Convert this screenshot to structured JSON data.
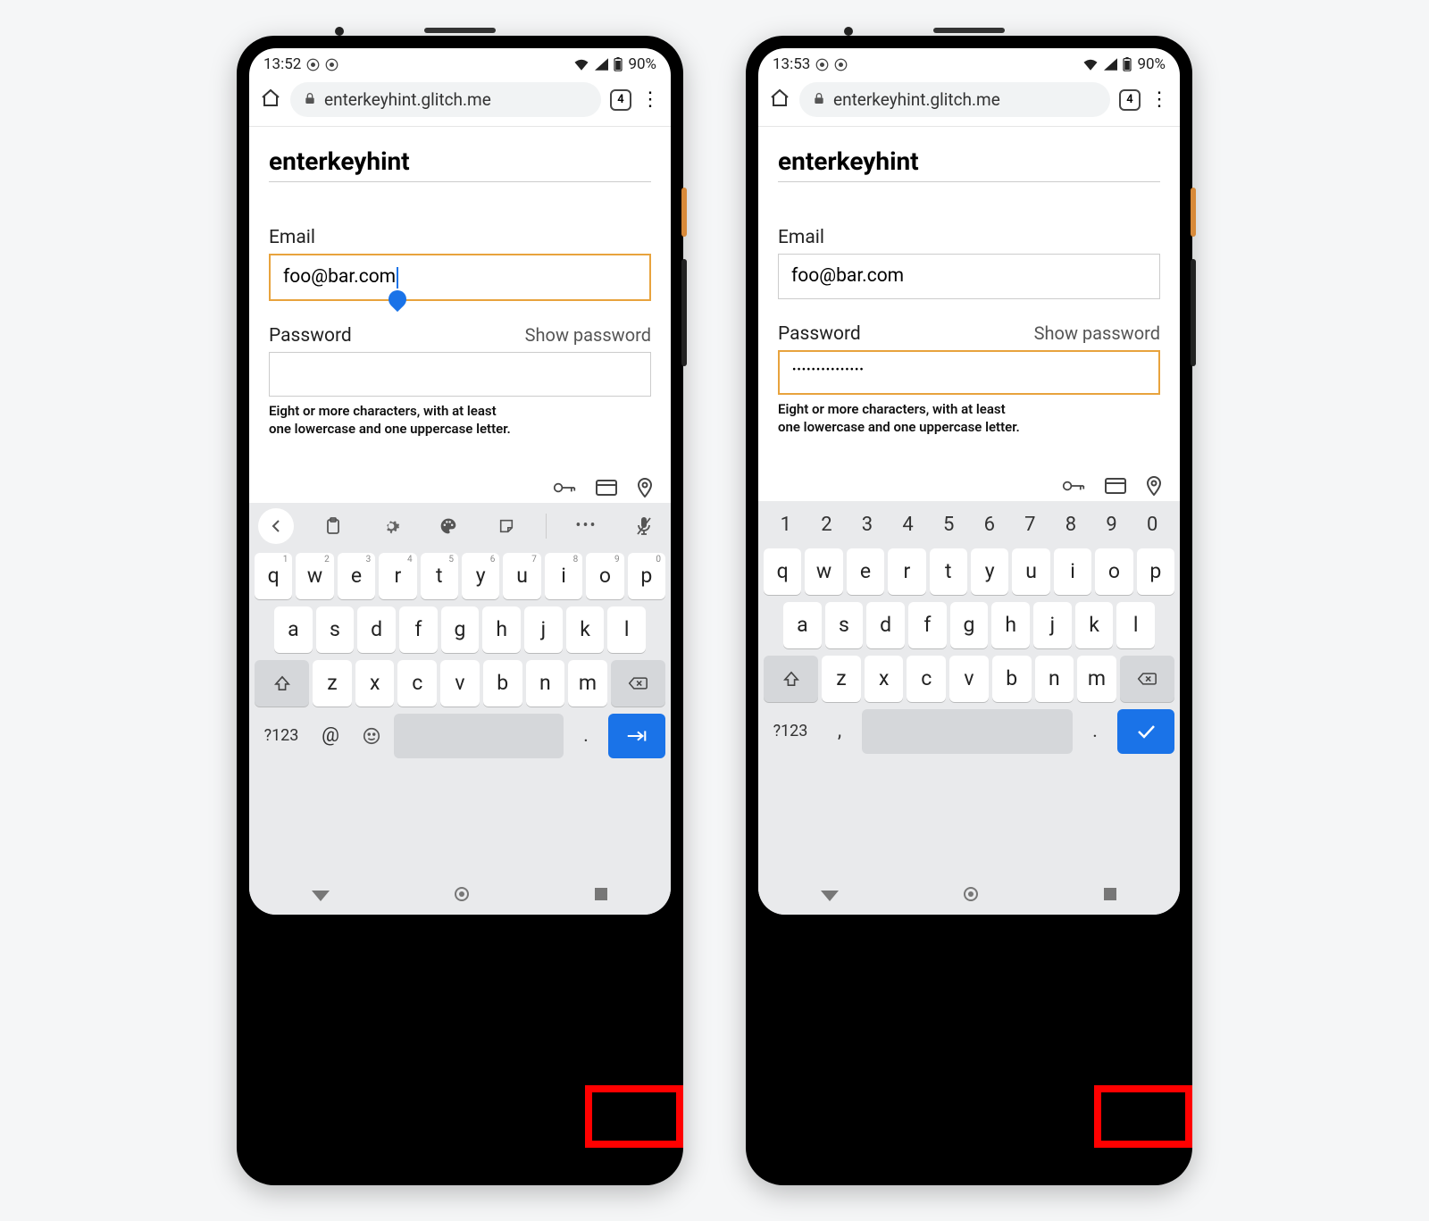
{
  "phones": [
    {
      "status": {
        "time": "13:52",
        "battery": "90%"
      },
      "url": "enterkeyhint.glitch.me",
      "tab_count": "4",
      "page": {
        "title": "enterkeyhint",
        "email_label": "Email",
        "email_value": "foo@bar.com",
        "email_focused": true,
        "password_label": "Password",
        "show_password": "Show password",
        "password_value": "",
        "password_focused": false,
        "hint_line1": "Eight or more characters, with at least",
        "hint_line2": "one lowercase and one uppercase letter."
      },
      "keyboard": {
        "has_toolbar": true,
        "has_number_row": false,
        "row1": [
          "q",
          "w",
          "e",
          "r",
          "t",
          "y",
          "u",
          "i",
          "o",
          "p"
        ],
        "row1_super": [
          "1",
          "2",
          "3",
          "4",
          "5",
          "6",
          "7",
          "8",
          "9",
          "0"
        ],
        "row2": [
          "a",
          "s",
          "d",
          "f",
          "g",
          "h",
          "j",
          "k",
          "l"
        ],
        "row3": [
          "z",
          "x",
          "c",
          "v",
          "b",
          "n",
          "m"
        ],
        "sym_label": "?123",
        "extra_key": "@",
        "period_key": ".",
        "enter_icon": "next"
      }
    },
    {
      "status": {
        "time": "13:53",
        "battery": "90%"
      },
      "url": "enterkeyhint.glitch.me",
      "tab_count": "4",
      "page": {
        "title": "enterkeyhint",
        "email_label": "Email",
        "email_value": "foo@bar.com",
        "email_focused": false,
        "password_label": "Password",
        "show_password": "Show password",
        "password_value": "•••••••••••••••",
        "password_focused": true,
        "hint_line1": "Eight or more characters, with at least",
        "hint_line2": "one lowercase and one uppercase letter."
      },
      "keyboard": {
        "has_toolbar": false,
        "has_number_row": true,
        "numbers": [
          "1",
          "2",
          "3",
          "4",
          "5",
          "6",
          "7",
          "8",
          "9",
          "0"
        ],
        "row1": [
          "q",
          "w",
          "e",
          "r",
          "t",
          "y",
          "u",
          "i",
          "o",
          "p"
        ],
        "row2": [
          "a",
          "s",
          "d",
          "f",
          "g",
          "h",
          "j",
          "k",
          "l"
        ],
        "row3": [
          "z",
          "x",
          "c",
          "v",
          "b",
          "n",
          "m"
        ],
        "sym_label": "?123",
        "extra_key": ",",
        "period_key": ".",
        "enter_icon": "done"
      }
    }
  ]
}
